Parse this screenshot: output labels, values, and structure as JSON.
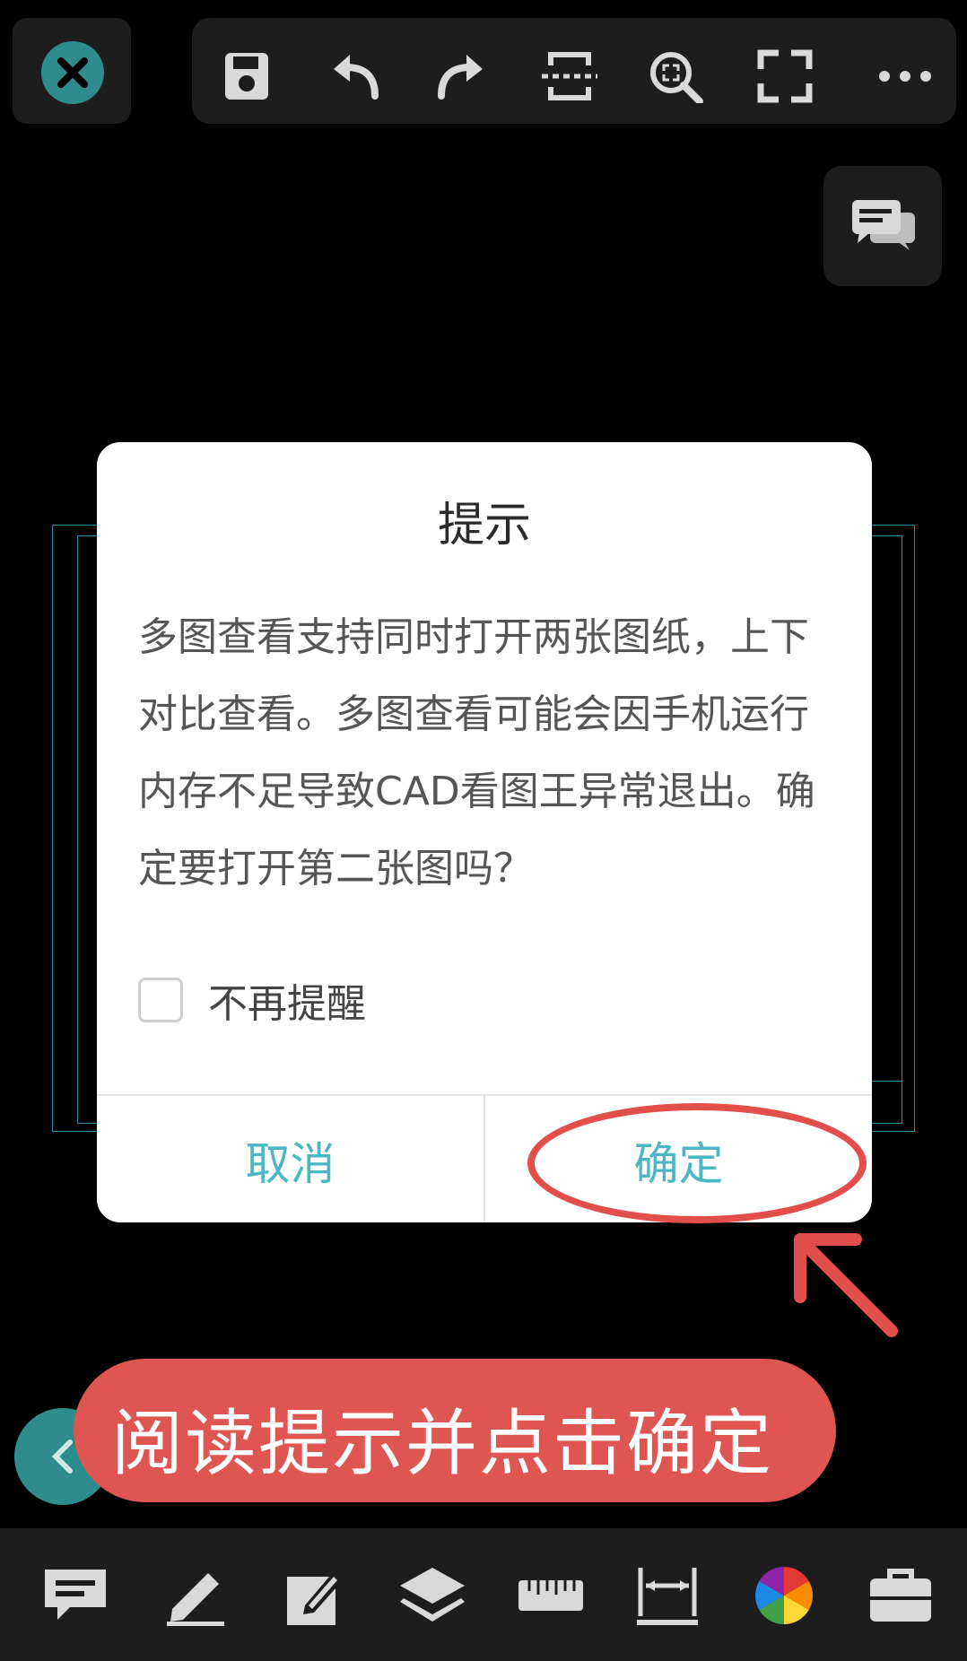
{
  "dialog": {
    "title": "提示",
    "message": "多图查看支持同时打开两张图纸，上下对比查看。多图查看可能会因手机运行内存不足导致CAD看图王异常退出。确定要打开第二张图吗？",
    "checkbox_label": "不再提醒",
    "cancel_label": "取消",
    "confirm_label": "确定"
  },
  "banner": {
    "text": "阅读提示并点击确定"
  },
  "colors": {
    "accent": "#4bb7c2",
    "annotation_red": "#e24f4b",
    "teal_button": "#2f8c8c"
  }
}
